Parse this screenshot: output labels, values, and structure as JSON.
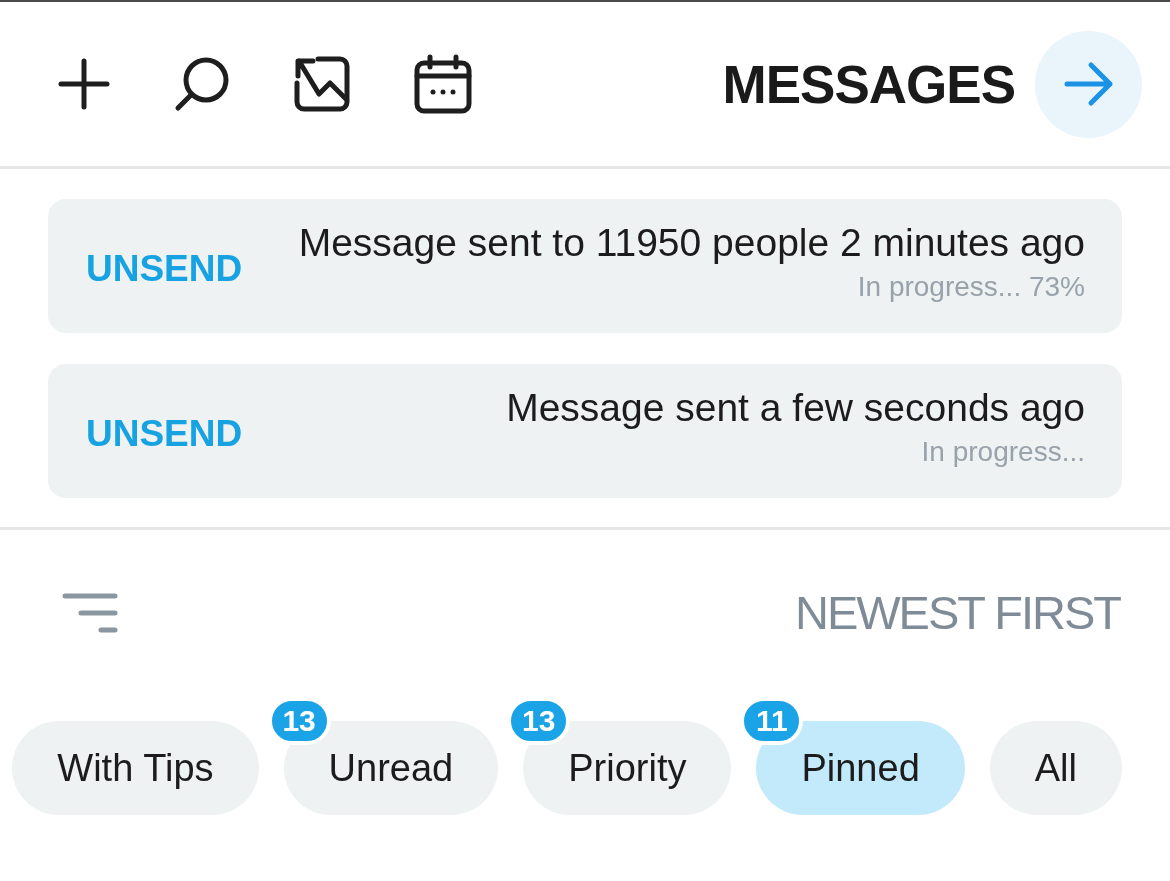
{
  "header": {
    "title": "MESSAGES"
  },
  "notices": [
    {
      "message": "Message sent to 11950 people 2 minutes ago",
      "status": "In progress... 73%",
      "action": "UNSEND"
    },
    {
      "message": "Message sent a few seconds ago",
      "status": "In progress...",
      "action": "UNSEND"
    }
  ],
  "sort": {
    "label": "NEWEST FIRST"
  },
  "filters": [
    {
      "label": "With Tips",
      "selected": false
    },
    {
      "label": "Unread",
      "selected": false,
      "count": "13"
    },
    {
      "label": "Priority",
      "selected": false,
      "count": "13"
    },
    {
      "label": "Pinned",
      "selected": true,
      "count": "11"
    },
    {
      "label": "All",
      "selected": false
    }
  ]
}
